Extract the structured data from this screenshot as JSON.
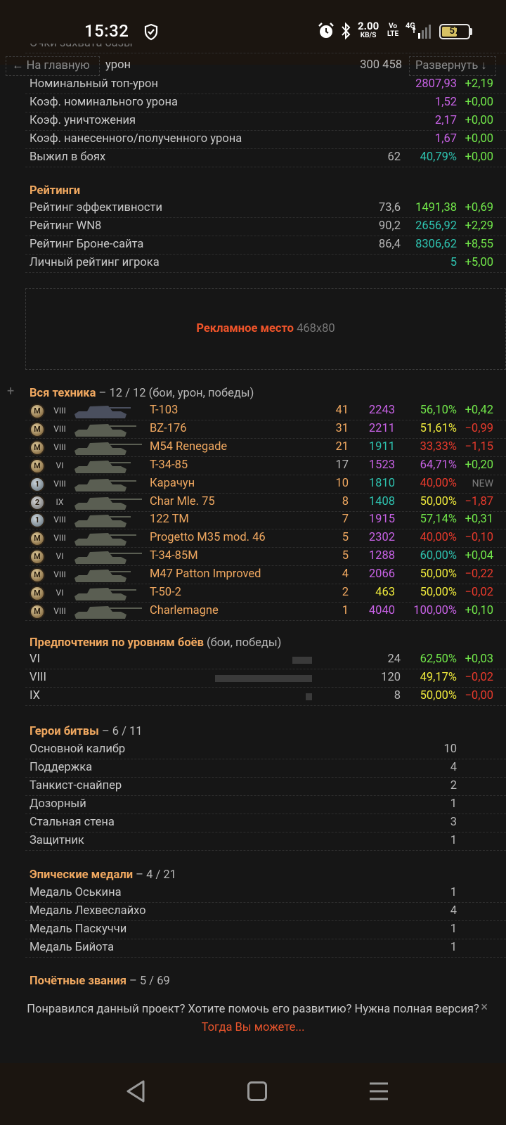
{
  "status_bar": {
    "time": "15:32",
    "speed_value": "2.00",
    "speed_unit": "KB/S",
    "volte_top": "Vo",
    "volte_bottom": "LTE",
    "network": "4G",
    "battery": "57",
    "icons": [
      "shield-check-icon",
      "alarm-icon",
      "bluetooth-icon",
      "signal-icon",
      "battery-icon"
    ]
  },
  "topbar": {
    "back_label": "← На главную",
    "expand_label": "Развернуть ↓",
    "cut_label": "Очки захвата базы",
    "damage_label": "урон",
    "damage_value": "300 458"
  },
  "general_rows": [
    {
      "label": "Номинальный топ-урон",
      "v1": "",
      "v2": "2807,93",
      "v2_color": "purple",
      "delta": "+2,19",
      "delta_color": "green"
    },
    {
      "label": "Коэф. номинального урона",
      "v1": "",
      "v2": "1,52",
      "v2_color": "purple",
      "delta": "+0,00",
      "delta_color": "green"
    },
    {
      "label": "Коэф. уничтожения",
      "v1": "",
      "v2": "2,17",
      "v2_color": "purple",
      "delta": "+0,00",
      "delta_color": "green"
    },
    {
      "label": "Коэф. нанесенного/полученного урона",
      "v1": "",
      "v2": "1,67",
      "v2_color": "purple",
      "delta": "+0,00",
      "delta_color": "green"
    },
    {
      "label": "Выжил в боях",
      "v1": "62",
      "v2": "40,79%",
      "v2_color": "teal",
      "delta": "+0,00",
      "delta_color": "green"
    }
  ],
  "ratings": {
    "title": "Рейтинги",
    "rows": [
      {
        "label": "Рейтинг эффективности",
        "v1": "73,6",
        "v2": "1491,38",
        "v2_color": "green",
        "delta": "+0,69"
      },
      {
        "label": "Рейтинг WN8",
        "v1": "90,2",
        "v2": "2656,92",
        "v2_color": "teal",
        "delta": "+2,29"
      },
      {
        "label": "Рейтинг Броне-сайта",
        "v1": "86,4",
        "v2": "8306,62",
        "v2_color": "teal",
        "delta": "+8,55"
      },
      {
        "label": "Личный рейтинг игрока",
        "v1": "",
        "v2": "5",
        "v2_color": "teal",
        "delta": "+5,00"
      }
    ]
  },
  "ad": {
    "label": "Рекламное место",
    "size": "468x80"
  },
  "vehicles": {
    "plus": "+",
    "title": "Вся техника",
    "subtitle": " – 12 / 12 (бои, урон, победы)",
    "rows": [
      {
        "medal": "M",
        "medal_type": "m0",
        "tier": "VIII",
        "name": "T-103",
        "name_color": "orange",
        "battles": "41",
        "battles_color": "orange",
        "damage": "2243",
        "damage_color": "purple",
        "win": "56,10%",
        "win_color": "green",
        "delta": "+0,42",
        "delta_color": "green"
      },
      {
        "medal": "M",
        "medal_type": "m0",
        "tier": "VIII",
        "name": "BZ-176",
        "name_color": "orange",
        "battles": "31",
        "battles_color": "orange",
        "damage": "2211",
        "damage_color": "purple",
        "win": "51,61%",
        "win_color": "yellow",
        "delta": "−0,99",
        "delta_color": "red"
      },
      {
        "medal": "M",
        "medal_type": "m0",
        "tier": "VIII",
        "name": "M54 Renegade",
        "name_color": "orange",
        "battles": "21",
        "battles_color": "orange",
        "damage": "1911",
        "damage_color": "teal",
        "win": "33,33%",
        "win_color": "red",
        "delta": "−1,15",
        "delta_color": "red"
      },
      {
        "medal": "M",
        "medal_type": "m0",
        "tier": "VI",
        "name": "T-34-85",
        "name_color": "gray",
        "battles": "17",
        "battles_color": "gray",
        "damage": "1523",
        "damage_color": "purple",
        "win": "64,71%",
        "win_color": "purple",
        "delta": "+0,20",
        "delta_color": "green"
      },
      {
        "medal": "1",
        "medal_type": "m1",
        "tier": "VIII",
        "name": "Карачун",
        "name_color": "orange",
        "battles": "10",
        "battles_color": "orange",
        "damage": "1810",
        "damage_color": "teal",
        "win": "40,00%",
        "win_color": "red",
        "delta": "NEW",
        "delta_color": "dimnew"
      },
      {
        "medal": "2",
        "medal_type": "m2",
        "tier": "IX",
        "name": "Char Mle. 75",
        "name_color": "orange",
        "battles": "8",
        "battles_color": "orange",
        "damage": "1408",
        "damage_color": "teal",
        "win": "50,00%",
        "win_color": "yellow",
        "delta": "−1,87",
        "delta_color": "red"
      },
      {
        "medal": "1",
        "medal_type": "m1",
        "tier": "VIII",
        "name": "122 TM",
        "name_color": "orange",
        "battles": "7",
        "battles_color": "orange",
        "damage": "1915",
        "damage_color": "purple",
        "win": "57,14%",
        "win_color": "green",
        "delta": "+0,31",
        "delta_color": "green"
      },
      {
        "medal": "M",
        "medal_type": "m0",
        "tier": "VIII",
        "name": "Progetto M35 mod. 46",
        "name_color": "orange",
        "battles": "5",
        "battles_color": "orange",
        "damage": "2302",
        "damage_color": "purple",
        "win": "40,00%",
        "win_color": "red",
        "delta": "−0,10",
        "delta_color": "red"
      },
      {
        "medal": "M",
        "medal_type": "m0",
        "tier": "VI",
        "name": "T-34-85M",
        "name_color": "orange",
        "battles": "5",
        "battles_color": "orange",
        "damage": "1288",
        "damage_color": "purple",
        "win": "60,00%",
        "win_color": "teal",
        "delta": "+0,04",
        "delta_color": "green"
      },
      {
        "medal": "M",
        "medal_type": "m0",
        "tier": "VIII",
        "name": "M47 Patton Improved",
        "name_color": "orange",
        "battles": "4",
        "battles_color": "orange",
        "damage": "2066",
        "damage_color": "purple",
        "win": "50,00%",
        "win_color": "yellow",
        "delta": "−0,22",
        "delta_color": "red"
      },
      {
        "medal": "M",
        "medal_type": "m0",
        "tier": "VI",
        "name": "T-50-2",
        "name_color": "orange",
        "battles": "2",
        "battles_color": "orange",
        "damage": "463",
        "damage_color": "yellow",
        "win": "50,00%",
        "win_color": "yellow",
        "delta": "−0,02",
        "delta_color": "red"
      },
      {
        "medal": "M",
        "medal_type": "m0",
        "tier": "VIII",
        "name": "Charlemagne",
        "name_color": "orange",
        "battles": "1",
        "battles_color": "orange",
        "damage": "4040",
        "damage_color": "purple",
        "win": "100,00%",
        "win_color": "purple",
        "delta": "+0,10",
        "delta_color": "green"
      }
    ]
  },
  "tiers": {
    "title": "Предпочтения по уровням боёв",
    "subtitle": " (бои, победы)",
    "rows": [
      {
        "label": "VI",
        "battles": "24",
        "share": 0.2,
        "win": "62,50%",
        "win_color": "green",
        "delta": "+0,03",
        "delta_color": "green"
      },
      {
        "label": "VIII",
        "battles": "120",
        "share": 1.0,
        "win": "49,17%",
        "win_color": "yellow",
        "delta": "−0,02",
        "delta_color": "red"
      },
      {
        "label": "IX",
        "battles": "8",
        "share": 0.067,
        "win": "50,00%",
        "win_color": "yellow",
        "delta": "−0,00",
        "delta_color": "red"
      }
    ]
  },
  "heroes": {
    "title": "Герои битвы",
    "subtitle": " – 6 / 11",
    "rows": [
      {
        "label": "Основной калибр",
        "value": "10"
      },
      {
        "label": "Поддержка",
        "value": "4"
      },
      {
        "label": "Танкист-снайпер",
        "value": "2"
      },
      {
        "label": "Дозорный",
        "value": "1"
      },
      {
        "label": "Стальная стена",
        "value": "3"
      },
      {
        "label": "Защитник",
        "value": "1"
      }
    ]
  },
  "epic": {
    "title": "Эпические медали",
    "subtitle": " – 4 / 21",
    "rows": [
      {
        "label": "Медаль Оськина",
        "value": "1"
      },
      {
        "label": "Медаль Лехвеслайхо",
        "value": "4"
      },
      {
        "label": "Медаль Паскуччи",
        "value": "1"
      },
      {
        "label": "Медаль Бийота",
        "value": "1"
      }
    ]
  },
  "honors": {
    "title": "Почётные звания",
    "subtitle": " – 5 / 69"
  },
  "footer": {
    "text": "Понравился данный проект? Хотите помочь его развитию? Нужна полная версия?",
    "link": "Тогда Вы можете...",
    "close": "×"
  },
  "navbar": {
    "icons": [
      "back-icon",
      "home-icon",
      "menu-icon"
    ]
  }
}
